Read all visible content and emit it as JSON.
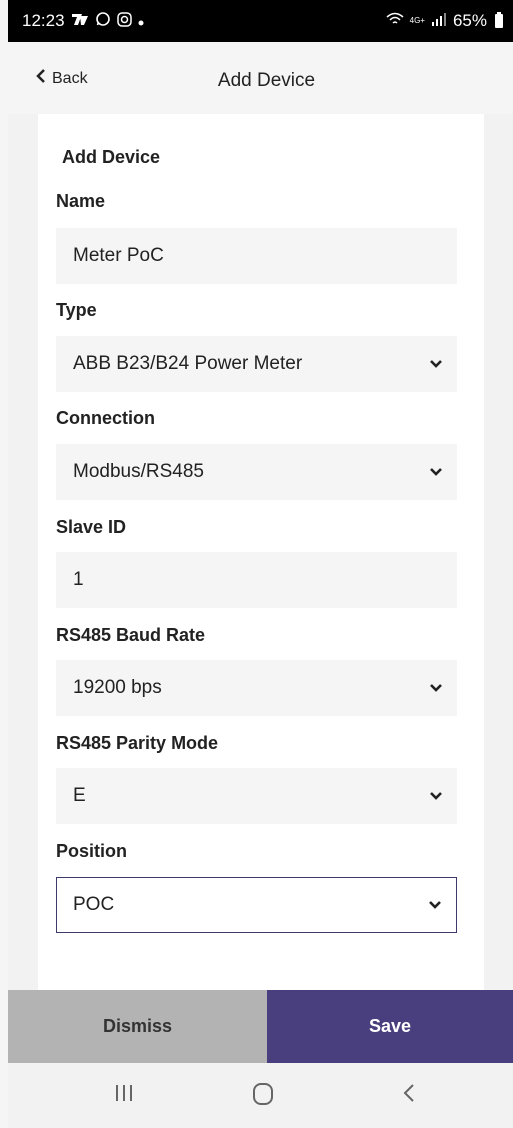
{
  "status_bar": {
    "time": "12:23",
    "battery": "65%",
    "network": "4G+"
  },
  "nav": {
    "back_label": "Back",
    "title": "Add Device"
  },
  "form": {
    "title": "Add Device",
    "fields": [
      {
        "label": "Name",
        "value": "Meter PoC",
        "type": "text"
      },
      {
        "label": "Type",
        "value": "ABB B23/B24 Power Meter",
        "type": "select"
      },
      {
        "label": "Connection",
        "value": "Modbus/RS485",
        "type": "select"
      },
      {
        "label": "Slave ID",
        "value": "1",
        "type": "text"
      },
      {
        "label": "RS485 Baud Rate",
        "value": "19200 bps",
        "type": "select"
      },
      {
        "label": "RS485 Parity Mode",
        "value": "E",
        "type": "select"
      },
      {
        "label": "Position",
        "value": "POC",
        "type": "select",
        "focused": true
      }
    ]
  },
  "actions": {
    "dismiss_label": "Dismiss",
    "save_label": "Save"
  },
  "colors": {
    "accent": "#4a3f7e",
    "dismiss_bg": "#b3b3b3",
    "field_bg": "#f5f5f5"
  },
  "icons": {
    "back": "chevron-left-icon",
    "select": "chevron-down-icon",
    "recents": "recents-icon",
    "home": "home-icon",
    "system_back": "system-back-icon"
  }
}
